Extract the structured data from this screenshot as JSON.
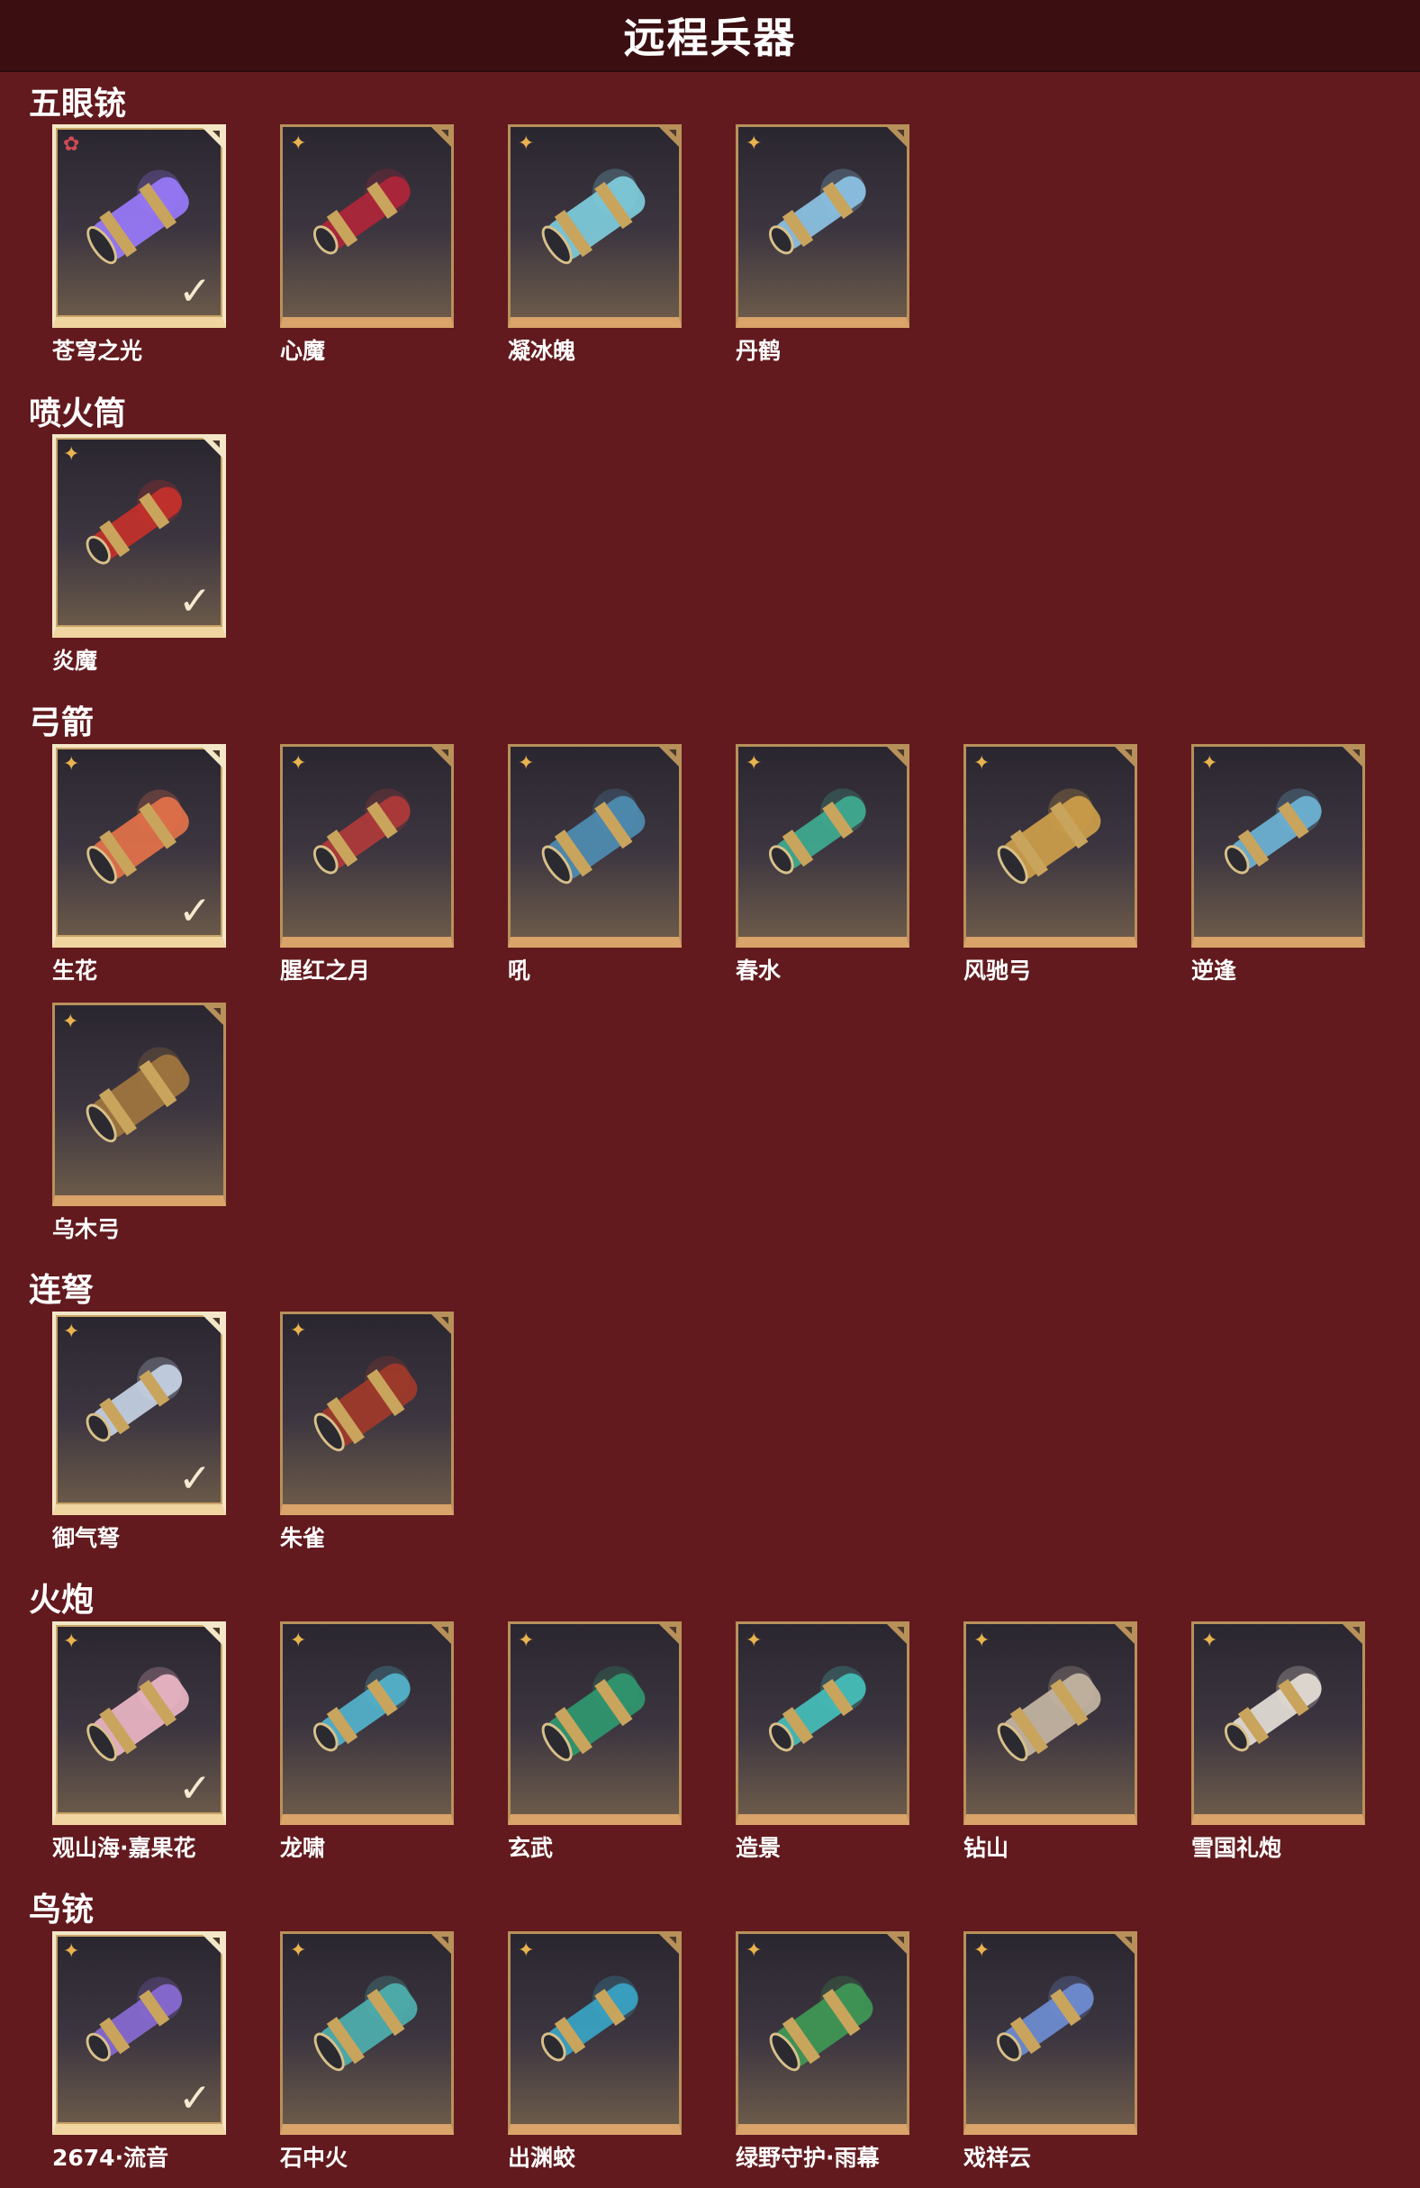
{
  "page_title": "远程兵器",
  "sections": [
    {
      "title": "五眼铳",
      "items": [
        {
          "name": "苍穹之光",
          "rank": "red",
          "selected": true,
          "art": "#9b7bff"
        },
        {
          "name": "心魔",
          "rank": "gold",
          "selected": false,
          "art": "#b2253a"
        },
        {
          "name": "凝冰魄",
          "rank": "gold",
          "selected": false,
          "art": "#7fd0e0"
        },
        {
          "name": "丹鹤",
          "rank": "gold",
          "selected": false,
          "art": "#8fc7e8"
        }
      ]
    },
    {
      "title": "喷火筒",
      "items": [
        {
          "name": "炎魔",
          "rank": "gold",
          "selected": true,
          "art": "#c8312a"
        }
      ]
    },
    {
      "title": "弓箭",
      "items": [
        {
          "name": "生花",
          "rank": "gold",
          "selected": true,
          "art": "#e8734a"
        },
        {
          "name": "腥红之月",
          "rank": "gold",
          "selected": false,
          "art": "#b23a3a"
        },
        {
          "name": "吼",
          "rank": "gold",
          "selected": false,
          "art": "#4f8fb5"
        },
        {
          "name": "春水",
          "rank": "gold",
          "selected": false,
          "art": "#3fae92"
        },
        {
          "name": "风驰弓",
          "rank": "gold",
          "selected": false,
          "art": "#d1a24a"
        },
        {
          "name": "逆逢",
          "rank": "gold",
          "selected": false,
          "art": "#6fb6d8"
        },
        {
          "name": "乌木弓",
          "rank": "gold",
          "selected": false,
          "art": "#a3783f"
        }
      ]
    },
    {
      "title": "连弩",
      "items": [
        {
          "name": "御气弩",
          "rank": "gold",
          "selected": true,
          "art": "#c9d6e8"
        },
        {
          "name": "朱雀",
          "rank": "gold",
          "selected": false,
          "art": "#a33a2a"
        }
      ]
    },
    {
      "title": "火炮",
      "items": [
        {
          "name": "观山海·嘉果花",
          "rank": "gold",
          "selected": true,
          "art": "#f0b9c9"
        },
        {
          "name": "龙啸",
          "rank": "gold",
          "selected": false,
          "art": "#54b6cf"
        },
        {
          "name": "玄武",
          "rank": "gold",
          "selected": false,
          "art": "#2f9a70"
        },
        {
          "name": "造景",
          "rank": "gold",
          "selected": false,
          "art": "#46c2bd"
        },
        {
          "name": "钻山",
          "rank": "gold",
          "selected": false,
          "art": "#c9b9a5"
        },
        {
          "name": "雪国礼炮",
          "rank": "gold",
          "selected": false,
          "art": "#e9e2da"
        }
      ]
    },
    {
      "title": "鸟铳",
      "items": [
        {
          "name": "2674·流音",
          "rank": "gold",
          "selected": true,
          "art": "#8a6bd6"
        },
        {
          "name": "石中火",
          "rank": "gold",
          "selected": false,
          "art": "#4fb3b0"
        },
        {
          "name": "出渊蛟",
          "rank": "gold",
          "selected": false,
          "art": "#3aa6c8"
        },
        {
          "name": "绿野守护·雨幕",
          "rank": "gold",
          "selected": false,
          "art": "#3f9a55"
        },
        {
          "name": "戏祥云",
          "rank": "gold",
          "selected": false,
          "art": "#6f8fd6"
        }
      ]
    }
  ]
}
